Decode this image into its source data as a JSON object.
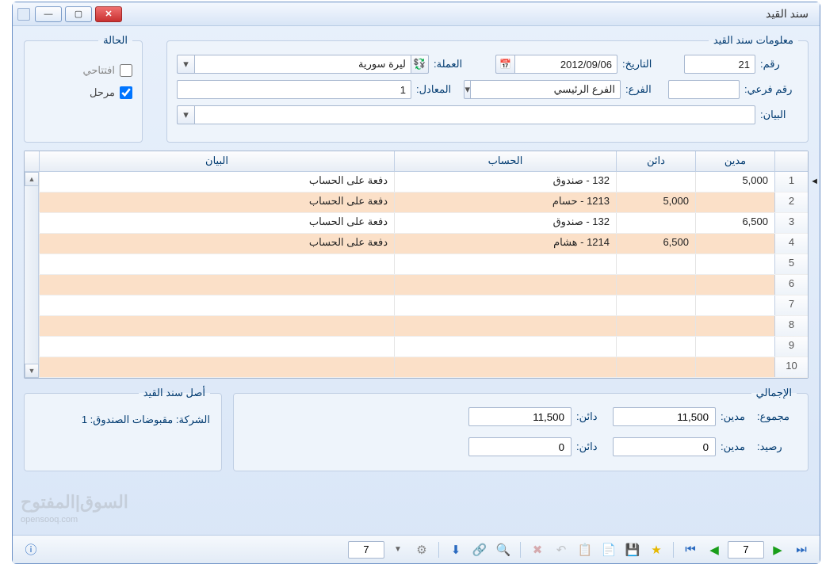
{
  "window": {
    "title": "سند القيد"
  },
  "section_info_title": "معلومات سند القيد",
  "section_status_title": "الحالة",
  "labels": {
    "number": "رقم:",
    "date": "التاريخ:",
    "currency": "العملة:",
    "subnumber": "رقم فرعي:",
    "branch": "الفرع:",
    "rate": "المعادل:",
    "statement": "البيان:"
  },
  "fields": {
    "number": "21",
    "date": "2012/09/06",
    "currency": "ليرة سورية",
    "subnumber": "",
    "branch": "الفرع الرئيسي",
    "rate": "1",
    "statement": ""
  },
  "status": {
    "opening_label": "افتتاحي",
    "opening_checked": false,
    "posted_label": "مرحل",
    "posted_checked": true
  },
  "grid": {
    "headers": {
      "debit": "مدين",
      "credit": "دائن",
      "account": "الحساب",
      "desc": "البيان"
    },
    "rows": [
      {
        "n": 1,
        "debit": "5,000",
        "credit": "",
        "account": "132 - صندوق",
        "desc": "دفعة على الحساب"
      },
      {
        "n": 2,
        "debit": "",
        "credit": "5,000",
        "account": "1213 - حسام",
        "desc": "دفعة على الحساب"
      },
      {
        "n": 3,
        "debit": "6,500",
        "credit": "",
        "account": "132 - صندوق",
        "desc": "دفعة على الحساب"
      },
      {
        "n": 4,
        "debit": "",
        "credit": "6,500",
        "account": "1214 - هشام",
        "desc": "دفعة على الحساب"
      },
      {
        "n": 5,
        "debit": "",
        "credit": "",
        "account": "",
        "desc": ""
      },
      {
        "n": 6,
        "debit": "",
        "credit": "",
        "account": "",
        "desc": ""
      },
      {
        "n": 7,
        "debit": "",
        "credit": "",
        "account": "",
        "desc": ""
      },
      {
        "n": 8,
        "debit": "",
        "credit": "",
        "account": "",
        "desc": ""
      },
      {
        "n": 9,
        "debit": "",
        "credit": "",
        "account": "",
        "desc": ""
      },
      {
        "n": 10,
        "debit": "",
        "credit": "",
        "account": "",
        "desc": ""
      }
    ]
  },
  "totals": {
    "section_title": "الإجمالي",
    "origin_title": "أصل سند القيد",
    "origin_text": "الشركة: مقبوضات الصندوق: 1",
    "sum_label": "مجموع:",
    "bal_label": "رصيد:",
    "debit_label": "مدين:",
    "credit_label": "دائن:",
    "sum_debit": "11,500",
    "sum_credit": "11,500",
    "bal_debit": "0",
    "bal_credit": "0"
  },
  "toolbar": {
    "record_current": "7",
    "record_field": "7"
  },
  "watermark": {
    "brand": "السوق|المفتوح",
    "site": "opensooq.com"
  }
}
